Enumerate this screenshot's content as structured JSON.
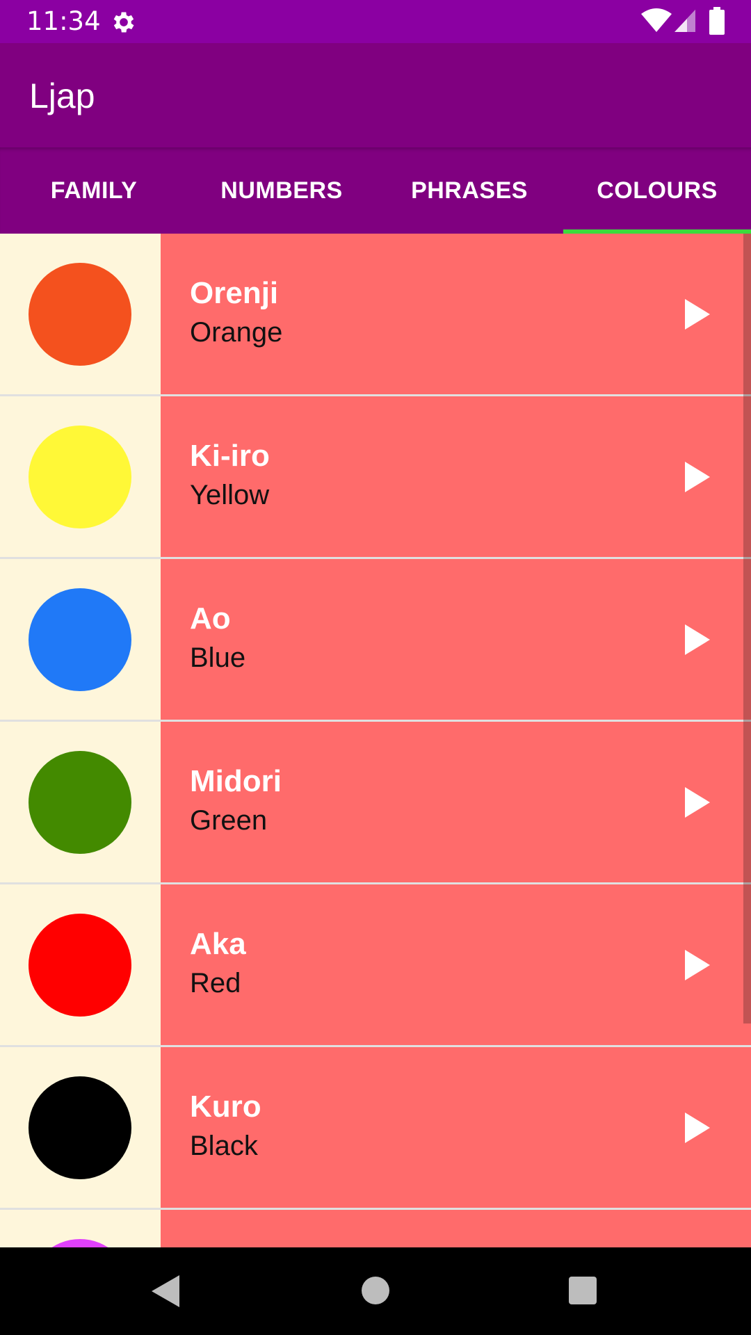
{
  "status_bar": {
    "time": "11:34",
    "background": "#8B00A2",
    "icons": [
      "gear-icon",
      "wifi-icon",
      "signal-icon",
      "battery-icon"
    ]
  },
  "app_bar": {
    "title": "Ljap",
    "background": "#800080"
  },
  "tabs": [
    {
      "label": "FAMILY",
      "selected": false
    },
    {
      "label": "NUMBERS",
      "selected": false
    },
    {
      "label": "PHRASES",
      "selected": false
    },
    {
      "label": "COLOURS",
      "selected": true
    }
  ],
  "tab_indicator_color": "#3CDB3C",
  "list": {
    "row_background": "#FF6B6B",
    "swatch_background": "#FEF6DB",
    "items": [
      {
        "word": "Orenji",
        "translation": "Orange",
        "color": "#F4511E",
        "icon": "play-icon"
      },
      {
        "word": "Ki-iro",
        "translation": "Yellow",
        "color": "#FFF837",
        "icon": "play-icon"
      },
      {
        "word": "Ao",
        "translation": "Blue",
        "color": "#2079F7",
        "icon": "play-icon"
      },
      {
        "word": "Midori",
        "translation": "Green",
        "color": "#438A00",
        "icon": "play-icon"
      },
      {
        "word": "Aka",
        "translation": "Red",
        "color": "#FF0000",
        "icon": "play-icon"
      },
      {
        "word": "Kuro",
        "translation": "Black",
        "color": "#000000",
        "icon": "play-icon"
      },
      {
        "word": "",
        "translation": "",
        "color": "#E040FB",
        "icon": "play-icon"
      }
    ]
  },
  "nav_bar": {
    "icons": [
      "back-icon",
      "home-icon",
      "recents-icon"
    ]
  }
}
